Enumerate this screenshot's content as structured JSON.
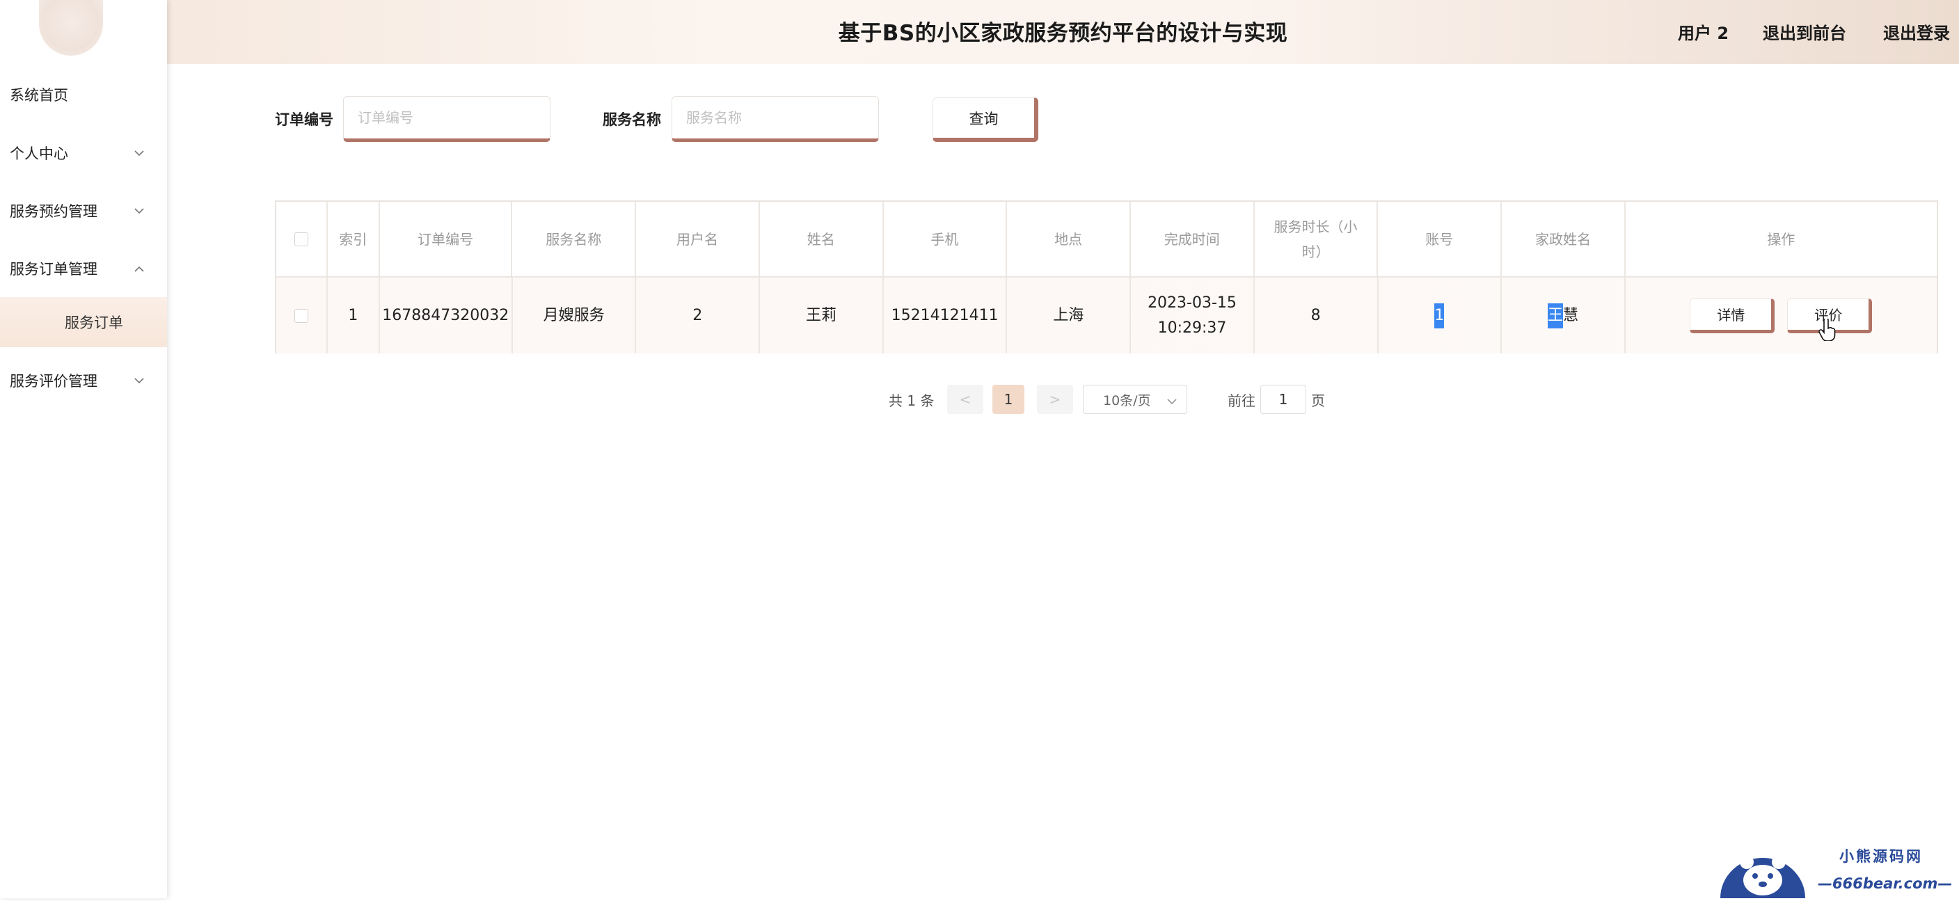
{
  "header": {
    "title": "基于BS的小区家政服务预约平台的设计与实现",
    "user": "用户 2",
    "back_front": "退出到前台",
    "logout": "退出登录"
  },
  "sidebar": {
    "items": [
      {
        "label": "系统首页"
      },
      {
        "label": "个人中心"
      },
      {
        "label": "服务预约管理"
      },
      {
        "label": "服务订单管理"
      },
      {
        "label": "服务评价管理"
      }
    ],
    "subitem": "服务订单"
  },
  "search": {
    "order_label": "订单编号",
    "order_placeholder": "订单编号",
    "service_label": "服务名称",
    "service_placeholder": "服务名称",
    "query_button": "查询"
  },
  "table": {
    "headers": [
      "索引",
      "订单编号",
      "服务名称",
      "用户名",
      "姓名",
      "手机",
      "地点",
      "完成时间",
      "服务时长（小时）",
      "账号",
      "家政姓名",
      "操作"
    ],
    "rows": [
      {
        "index": "1",
        "order_no": "1678847320032",
        "service": "月嫂服务",
        "username": "2",
        "name": "王莉",
        "phone": "15214121411",
        "location": "上海",
        "finish_time": "2023-03-15 10:29:37",
        "duration": "8",
        "account": "1",
        "housekeeper_first": "王",
        "housekeeper_rest": "慧",
        "btn_detail": "详情",
        "btn_review": "评价"
      }
    ]
  },
  "pager": {
    "total": "共 1 条",
    "prev": "<",
    "page": "1",
    "next": ">",
    "size": "10条/页",
    "goto": "前往",
    "goto_value": "1",
    "page_suffix": "页"
  },
  "watermark": {
    "line1": "小熊源码网",
    "line2": "—666bear.com—"
  }
}
